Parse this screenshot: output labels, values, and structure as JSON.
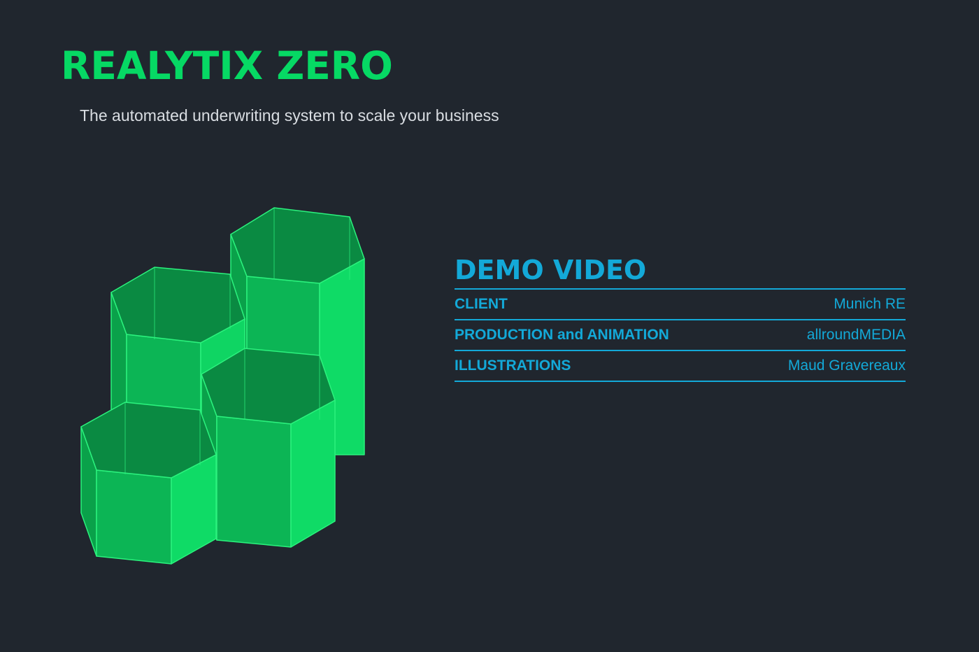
{
  "header": {
    "title": "REALYTIX ZERO",
    "subtitle": "The automated underwriting system to scale your business"
  },
  "illustration": {
    "icon": "hexagonal-prisms-icon",
    "color": "#06d964"
  },
  "credits": {
    "heading": "DEMO VIDEO",
    "rows": [
      {
        "label": "CLIENT",
        "value": "Munich RE"
      },
      {
        "label": "PRODUCTION and ANIMATION",
        "value": "allroundMEDIA"
      },
      {
        "label": "ILLUSTRATIONS",
        "value": "Maud Gravereaux"
      }
    ]
  },
  "colors": {
    "background": "#20262e",
    "accent_green": "#06d964",
    "accent_blue": "#13a9d8",
    "subtitle_text": "#d9dde2"
  }
}
